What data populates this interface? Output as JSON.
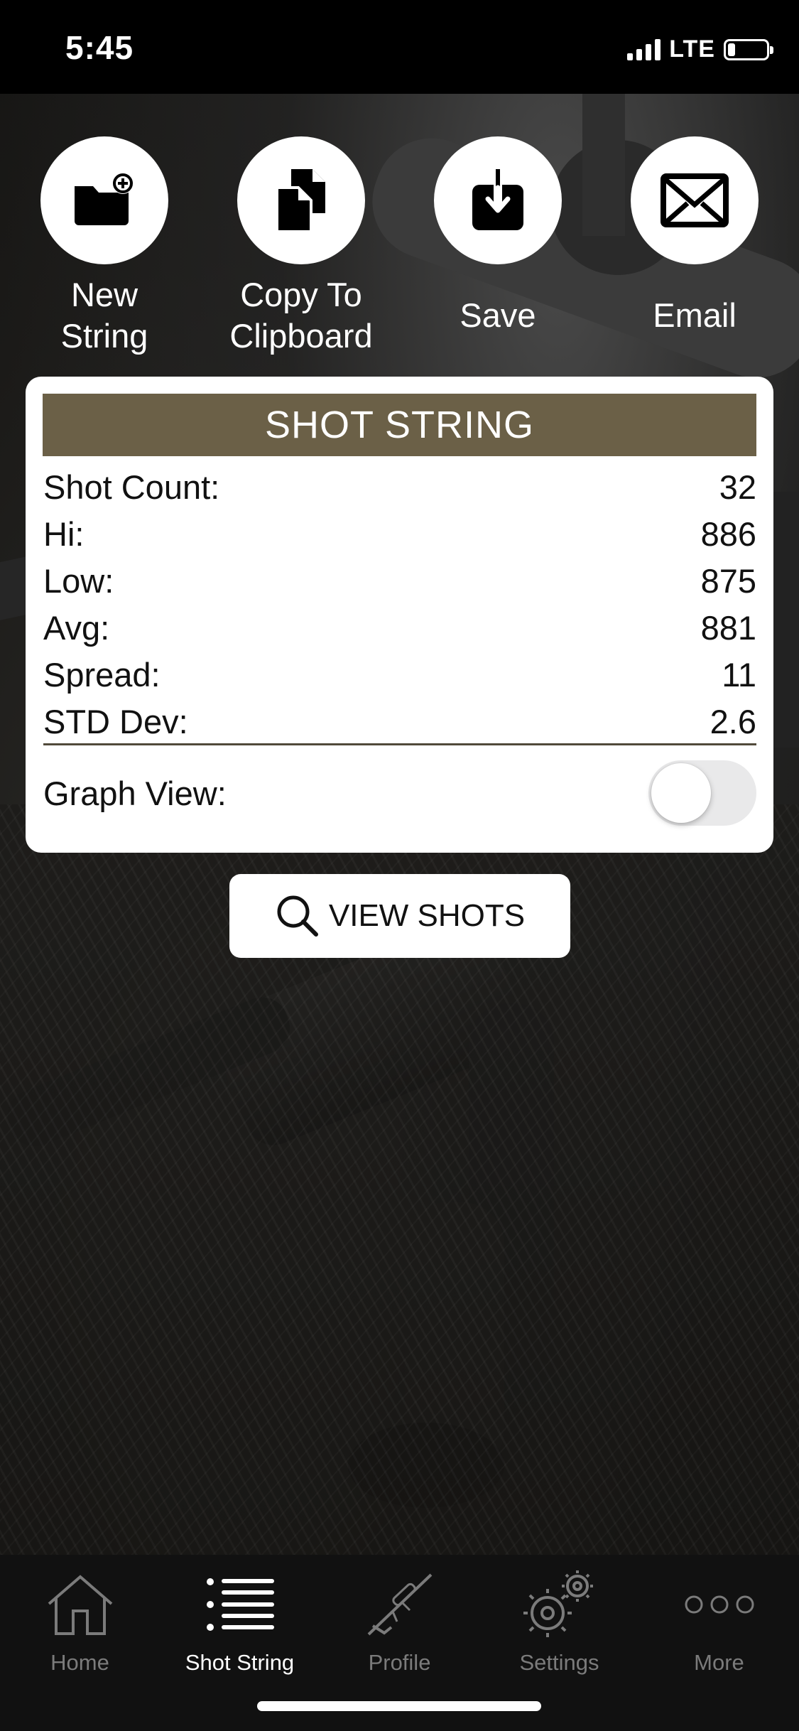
{
  "status_bar": {
    "time": "5:45",
    "network": "LTE",
    "battery_level": 0.2
  },
  "actions": [
    {
      "label": "New\nString",
      "icon": "folder-add-icon"
    },
    {
      "label": "Copy To\nClipboard",
      "icon": "copy-icon"
    },
    {
      "label": "Save",
      "icon": "download-icon"
    },
    {
      "label": "Email",
      "icon": "mail-icon"
    }
  ],
  "shot_string": {
    "title": "SHOT STRING",
    "stats": [
      {
        "label": "Shot Count:",
        "value": "32"
      },
      {
        "label": "Hi:",
        "value": "886"
      },
      {
        "label": "Low:",
        "value": "875"
      },
      {
        "label": "Avg:",
        "value": "881"
      },
      {
        "label": "Spread:",
        "value": "11"
      },
      {
        "label": "STD Dev:",
        "value": "2.6"
      }
    ],
    "graph_view_label": "Graph View:",
    "graph_view_on": false
  },
  "view_shots": {
    "label": "VIEW SHOTS",
    "icon": "search-icon"
  },
  "tab_bar": {
    "tabs": [
      {
        "label": "Home",
        "icon": "home-icon",
        "active": false
      },
      {
        "label": "Shot String",
        "icon": "list-icon",
        "active": true
      },
      {
        "label": "Profile",
        "icon": "rifle-icon",
        "active": false
      },
      {
        "label": "Settings",
        "icon": "gear-icon",
        "active": false
      },
      {
        "label": "More",
        "icon": "more-icon",
        "active": false
      }
    ]
  },
  "colors": {
    "header_brown": "#6b6047",
    "divider": "#514a3a",
    "tab_active": "#ffffff",
    "tab_inactive": "#7b7b7b"
  }
}
